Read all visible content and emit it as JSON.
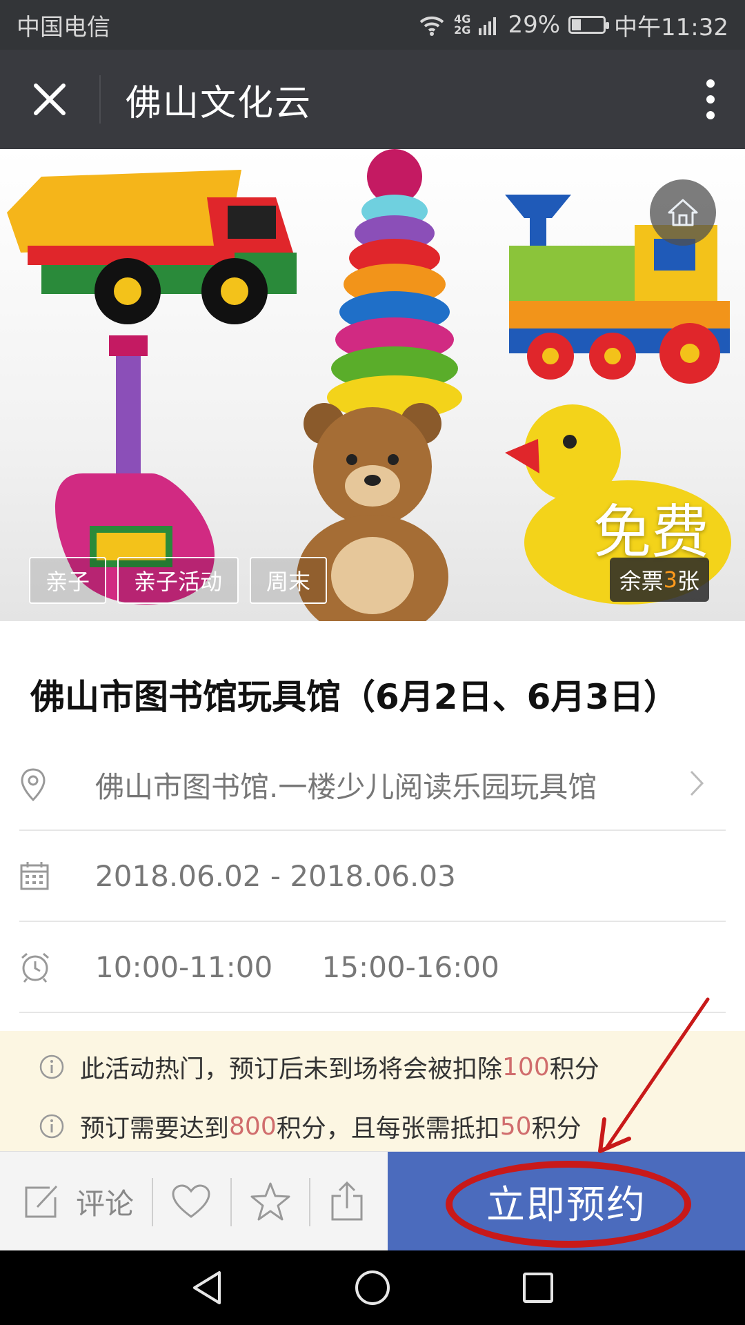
{
  "status_bar": {
    "carrier": "中国电信",
    "network": [
      "4G",
      "2G"
    ],
    "battery": "29%",
    "battery_level": 0.29,
    "time": "中午11:32"
  },
  "title_bar": {
    "title": "佛山文化云"
  },
  "banner": {
    "tags": [
      "亲子",
      "亲子活动",
      "周末"
    ],
    "price": "免费",
    "tickets": {
      "prefix": "余票",
      "count": "3",
      "suffix": "张"
    }
  },
  "event": {
    "title": "佛山市图书馆玩具馆（6月2日、6月3日）",
    "location": "佛山市图书馆.一楼少儿阅读乐园玩具馆",
    "dates": "2018.06.02 - 2018.06.03",
    "times": [
      "10:00-11:00",
      "15:00-16:00"
    ]
  },
  "notices": [
    {
      "before": "此活动热门，预订后未到场将会被扣除",
      "value": "100",
      "after": "积分"
    },
    {
      "before": "预订需要达到",
      "value": "800",
      "middle": "积分，且每张需抵扣",
      "value2": "50",
      "after": "积分"
    }
  ],
  "action_bar": {
    "comment_label": "评论",
    "book_label": "立即预约"
  },
  "colors": {
    "accent_blue": "#4b6bbd",
    "highlight": "#d06d6d",
    "annotation_red": "#c81919"
  }
}
